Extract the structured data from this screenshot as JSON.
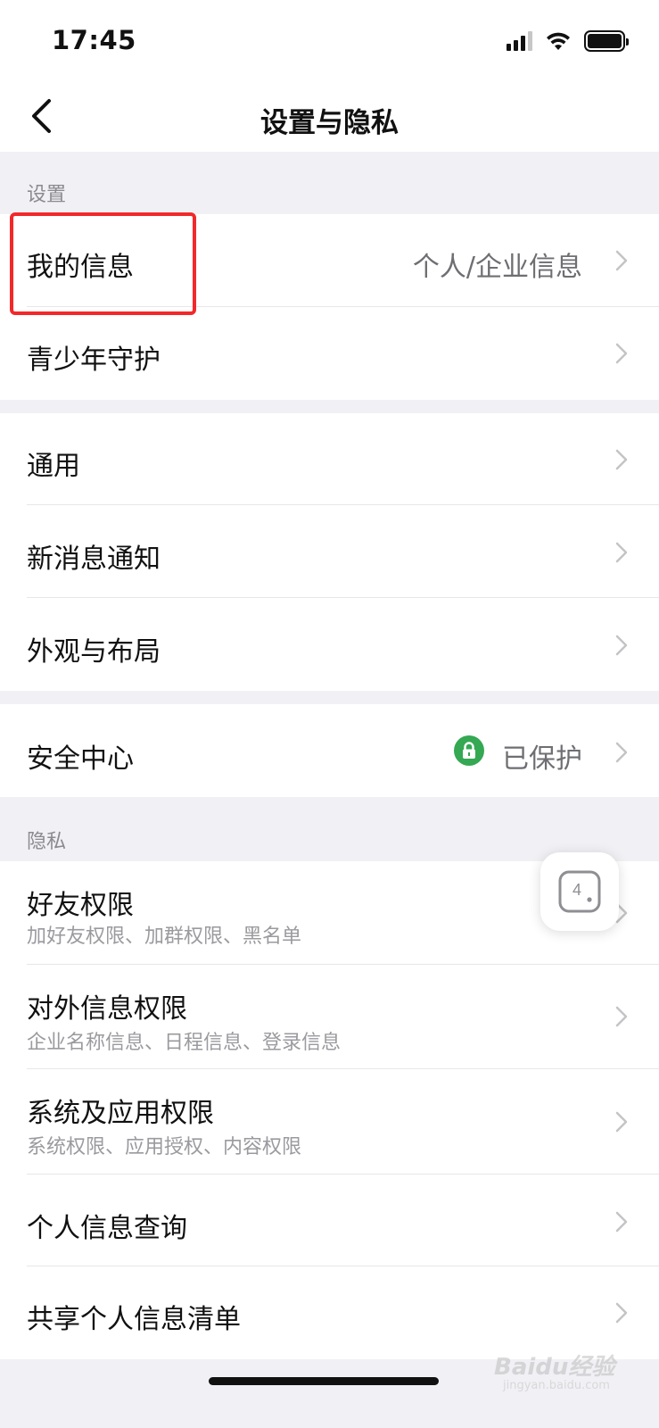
{
  "status_bar": {
    "time": "17:45"
  },
  "nav": {
    "title": "设置与隐私"
  },
  "sections": {
    "settings_header": "设置",
    "privacy_header": "隐私"
  },
  "settings_group": {
    "my_info": {
      "label": "我的信息",
      "value": "个人/企业信息"
    },
    "youth_protection": {
      "label": "青少年守护"
    }
  },
  "general_group": {
    "general": {
      "label": "通用"
    },
    "new_message_notification": {
      "label": "新消息通知"
    },
    "appearance_layout": {
      "label": "外观与布局"
    }
  },
  "security_group": {
    "security_center": {
      "label": "安全中心",
      "value": "已保护"
    }
  },
  "privacy_group": {
    "friend_permissions": {
      "label": "好友权限",
      "sub": "加好友权限、加群权限、黑名单"
    },
    "external_info_permissions": {
      "label": "对外信息权限",
      "sub": "企业名称信息、日程信息、登录信息"
    },
    "system_app_permissions": {
      "label": "系统及应用权限",
      "sub": "系统权限、应用授权、内容权限"
    },
    "personal_info_query": {
      "label": "个人信息查询"
    },
    "shared_personal_info_list": {
      "label": "共享个人信息清单"
    }
  },
  "float_button": {
    "badge": "4"
  },
  "watermark": {
    "text": "Baidu经验",
    "url": "jingyan.baidu.com"
  },
  "colors": {
    "background": "#f1f1f5",
    "card": "#ffffff",
    "highlight": "#f2282a",
    "lock_green": "#34a853",
    "secondary_text": "#6e6e73"
  },
  "icons": [
    "back-arrow-icon",
    "chevron-right-icon",
    "lock-icon",
    "signal-icon",
    "wifi-icon",
    "battery-icon",
    "floating-window-icon"
  ]
}
